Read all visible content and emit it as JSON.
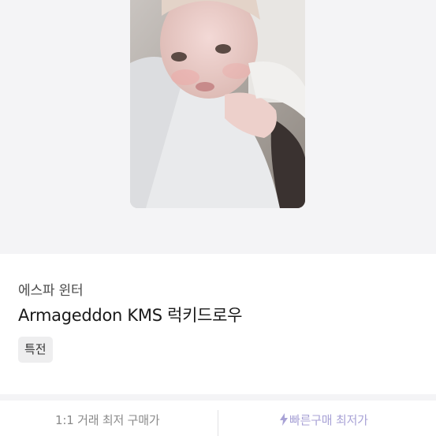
{
  "product": {
    "artist": "에스파 윈터",
    "title": "Armageddon KMS 럭키드로우",
    "tag": "특전",
    "image_alt": "photocard"
  },
  "price_bar": {
    "left_label": "1:1 거래 최저 구매가",
    "right_label": "빠른구매 최저가",
    "right_icon": "lightning-icon",
    "accent_color": "#a8a2d6"
  }
}
